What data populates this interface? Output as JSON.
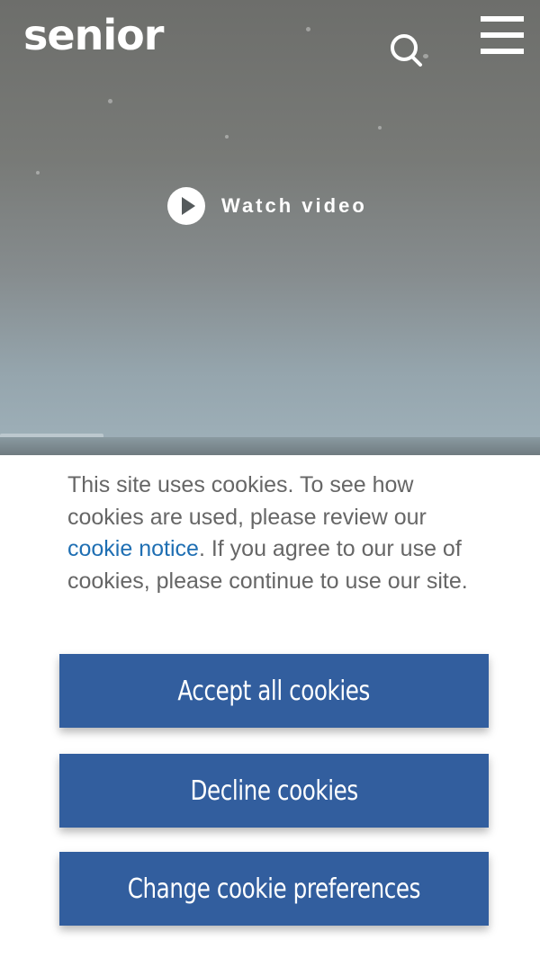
{
  "header": {
    "logo_text": "senior",
    "search_icon": "search-icon",
    "menu_icon": "hamburger-menu-icon"
  },
  "hero": {
    "watch_label": "Watch video",
    "play_icon": "play-icon"
  },
  "cookie_banner": {
    "text_before": "This site uses cookies. To see how cookies are used, please review our ",
    "link_text": "cookie notice",
    "text_after": ". If you agree to our use of cookies, please continue to use our site.",
    "accept_label": "Accept all cookies",
    "decline_label": "Decline cookies",
    "preferences_label": "Change cookie preferences"
  },
  "colors": {
    "button_bg": "#325e9e",
    "link": "#1f6fb3",
    "body_text": "#666666"
  }
}
